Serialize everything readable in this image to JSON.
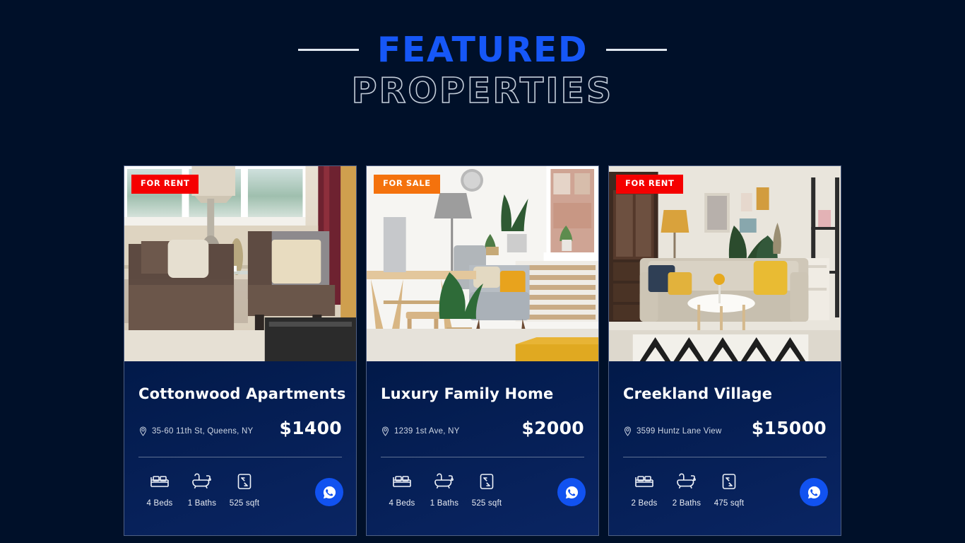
{
  "header": {
    "line1": "FEATURED",
    "line2": "PROPERTIES",
    "accent_color": "#1657f7",
    "rule_color": "#dfe6ef"
  },
  "colors": {
    "page_background": "#001029",
    "card_background_start": "#001a52",
    "card_background_end": "#0a2563",
    "card_border": "#4e5f82",
    "badge_rent": "#f50000",
    "badge_sale": "#f4720d",
    "whatsapp_button": "#1152f0",
    "divider": "#5f7194"
  },
  "cards": [
    {
      "badge": {
        "label": "FOR RENT",
        "type": "rent"
      },
      "title": "Cottonwood Apartments",
      "address": "35-60 11th St, Queens, NY",
      "price": "$1400",
      "specs": [
        {
          "icon": "bed-icon",
          "label": "4 Beds"
        },
        {
          "icon": "bath-icon",
          "label": "1 Baths"
        },
        {
          "icon": "area-icon",
          "label": "525 sqft"
        }
      ],
      "contact_button": {
        "icon": "whatsapp-icon"
      },
      "photo_alt": "living room with two armchairs, table lamp, window and red curtain"
    },
    {
      "badge": {
        "label": "FOR SALE",
        "type": "sale"
      },
      "title": "Luxury Family Home",
      "address": "1239 1st Ave, NY",
      "price": "$2000",
      "specs": [
        {
          "icon": "bed-icon",
          "label": "4 Beds"
        },
        {
          "icon": "bath-icon",
          "label": "1 Baths"
        },
        {
          "icon": "area-icon",
          "label": "525 sqft"
        }
      ],
      "contact_button": {
        "icon": "whatsapp-icon"
      },
      "photo_alt": "bright scandinavian room with wooden desk, grey armchair, plants and yellow rug"
    },
    {
      "badge": {
        "label": "FOR RENT",
        "type": "rent"
      },
      "title": "Creekland Village",
      "address": "3599 Huntz Lane View",
      "price": "$15000",
      "specs": [
        {
          "icon": "bed-icon",
          "label": "2 Beds"
        },
        {
          "icon": "bath-icon",
          "label": "2 Baths"
        },
        {
          "icon": "area-icon",
          "label": "475 sqft"
        }
      ],
      "contact_button": {
        "icon": "whatsapp-icon"
      },
      "photo_alt": "beige sofa with yellow cushions, round coffee table, geometric rug and dark cabinet"
    }
  ]
}
